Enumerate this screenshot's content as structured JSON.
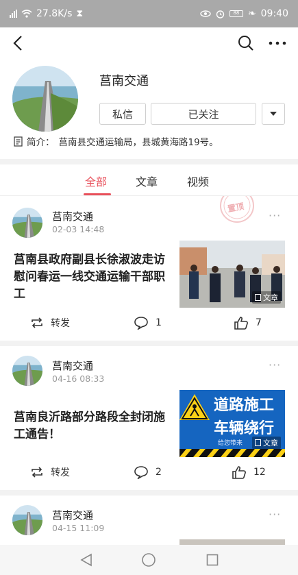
{
  "status_bar": {
    "network_speed": "27.8K/s",
    "time": "09:40",
    "battery": "88"
  },
  "profile": {
    "name": "莒南交通",
    "message_button": "私信",
    "follow_button": "已关注",
    "intro_label": "简介：",
    "intro_text": "莒南县交通运输局，县城黄海路19号。"
  },
  "tabs": [
    {
      "label": "全部",
      "active": true
    },
    {
      "label": "文章",
      "active": false
    },
    {
      "label": "视频",
      "active": false
    }
  ],
  "posts": [
    {
      "author": "莒南交通",
      "time": "02-03 14:48",
      "pinned_stamp": "置顶",
      "title": "莒南县政府副县长徐淑波走访慰问春运一线交通运输干部职工",
      "thumb_badge": "文章",
      "repost_label": "转发",
      "comments": "1",
      "likes": "7"
    },
    {
      "author": "莒南交通",
      "time": "04-16 08:33",
      "title": "莒南良沂路部分路段全封闭施工通告！",
      "thumb_text_line1": "道路施工",
      "thumb_text_line2": "车辆绕行",
      "thumb_small_text": "给您带来",
      "thumb_badge": "文章",
      "repost_label": "转发",
      "comments": "2",
      "likes": "12"
    },
    {
      "author": "莒南交通",
      "time": "04-15 11:09"
    }
  ],
  "colors": {
    "accent": "#e8505b",
    "status_bar": "#a9a9a9",
    "separator": "#f2f2f2",
    "sign_blue": "#1565c0"
  }
}
